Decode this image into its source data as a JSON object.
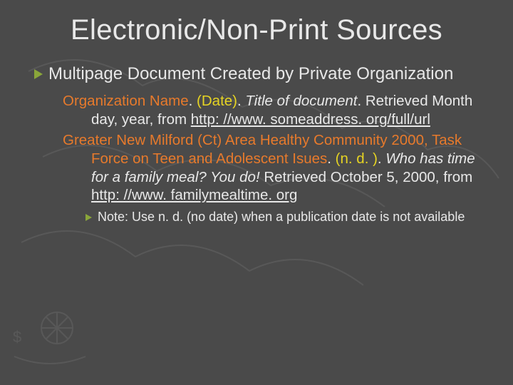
{
  "title": "Electronic/Non-Print Sources",
  "heading": "Multipage Document Created by Private Organization",
  "format": {
    "org": "Organization Name",
    "dot1": ". ",
    "date": "(Date)",
    "dot2": ". ",
    "doc_title": "Title of document",
    "dot3": ". Retrieved Month day, year, from ",
    "url": "http: //www. someaddress. org/full/url"
  },
  "example": {
    "org": "Greater New Milford (Ct) Area Healthy Community 2000, Task Force on Teen and Adolescent Isues",
    "dot1": ". ",
    "date": "(n. d. )",
    "dot2": ". ",
    "doc_title": "Who has time for a family meal? You do!",
    "rest": " Retrieved October 5, 2000, from ",
    "url": "http: //www. familymealtime. org"
  },
  "note": {
    "label": "Note: ",
    "text": "Use n. d. (no date) when a publication date is not available"
  }
}
